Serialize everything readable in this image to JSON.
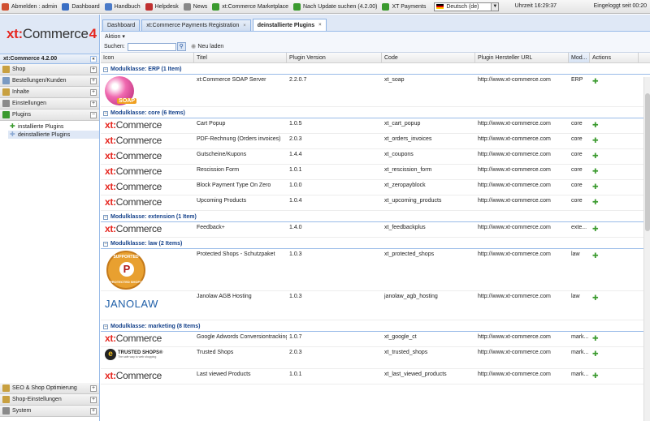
{
  "toolbar": {
    "items": [
      {
        "label": "Abmelden : admin",
        "icon": "logout-icon",
        "color": "#d05030"
      },
      {
        "label": "Dashboard",
        "icon": "dashboard-icon",
        "color": "#3a6fc4"
      },
      {
        "label": "Handbuch",
        "icon": "book-icon",
        "color": "#4a7ac8"
      },
      {
        "label": "Helpdesk",
        "icon": "helpdesk-icon",
        "color": "#c03030"
      },
      {
        "label": "News",
        "icon": "news-icon",
        "color": "#888888"
      },
      {
        "label": "xt:Commerce Marketplace",
        "icon": "marketplace-icon",
        "color": "#3a9a2e"
      },
      {
        "label": "Nach Update suchen (4.2.00)",
        "icon": "update-icon",
        "color": "#3a9a2e"
      },
      {
        "label": "XT Payments",
        "icon": "payments-icon",
        "color": "#3a9a2e"
      }
    ],
    "language": "Deutsch (de)",
    "time": "Uhrzeit 16:29:37",
    "login": "Eingeloggt seit 00:20"
  },
  "sidebar": {
    "logo_prefix": "xt",
    "logo_colon": ":",
    "logo_word": "Commerce",
    "logo_version": "4",
    "version": "xt:Commerce 4.2.00",
    "collapse": "«",
    "sections": [
      {
        "label": "Shop",
        "color": "#c8a040"
      },
      {
        "label": "Bestellungen/Kunden",
        "color": "#7a9ac2"
      },
      {
        "label": "Inhalte",
        "color": "#c8a040"
      },
      {
        "label": "Einstellungen",
        "color": "#8a8a8a"
      }
    ],
    "plugins_label": "Plugins",
    "expand": "+",
    "collapse_section": "−",
    "tree": [
      "installierte Plugins",
      "deinstallierte Plugins"
    ],
    "bottom_sections": [
      {
        "label": "SEO & Shop Optimierung",
        "color": "#c8a040"
      },
      {
        "label": "Shop-Einstellungen",
        "color": "#c8a040"
      },
      {
        "label": "System",
        "color": "#8a8a8a"
      }
    ]
  },
  "tabs": [
    {
      "label": "Dashboard",
      "active": false
    },
    {
      "label": "xt:Commerce Payments Registration",
      "active": false
    },
    {
      "label": "deinstallierte Plugins",
      "active": true
    }
  ],
  "tab_close": "×",
  "action_label": "Aktion ▾",
  "search": {
    "label": "Suchen:",
    "value": "",
    "reload": "Neu laden"
  },
  "columns": [
    "Icon",
    "Titel",
    "Plugin Version",
    "Code",
    "Plugin Hersteller URL",
    "Mod...",
    "Actions"
  ],
  "groups": [
    {
      "label": "Modulklasse: ERP (1 Item)",
      "rows": [
        {
          "icon": "soap",
          "title": "xt:Commerce SOAP Server",
          "version": "2.2.0.7",
          "code": "xt_soap",
          "url": "http://www.xt-commerce.com",
          "mod": "ERP"
        }
      ]
    },
    {
      "label": "Modulklasse: core (6 Items)",
      "rows": [
        {
          "icon": "xt",
          "title": "Cart Popup",
          "version": "1.0.5",
          "code": "xt_cart_popup",
          "url": "http://www.xt-commerce.com",
          "mod": "core"
        },
        {
          "icon": "xt",
          "title": "PDF-Rechnung (Orders invoices)",
          "version": "2.0.3",
          "code": "xt_orders_invoices",
          "url": "http://www.xt-commerce.com",
          "mod": "core"
        },
        {
          "icon": "xt",
          "title": "Gutscheine/Kupons",
          "version": "1.4.4",
          "code": "xt_coupons",
          "url": "http://www.xt-commerce.com",
          "mod": "core"
        },
        {
          "icon": "xt",
          "title": "Rescission Form",
          "version": "1.0.1",
          "code": "xt_rescission_form",
          "url": "http://www.xt-commerce.com",
          "mod": "core"
        },
        {
          "icon": "xt",
          "title": "Block Payment Type On Zero",
          "version": "1.0.0",
          "code": "xt_zeropayblock",
          "url": "http://www.xt-commerce.com",
          "mod": "core"
        },
        {
          "icon": "xt",
          "title": "Upcoming Products",
          "version": "1.0.4",
          "code": "xt_upcoming_products",
          "url": "http://www.xt-commerce.com",
          "mod": "core"
        }
      ]
    },
    {
      "label": "Modulklasse: extension (1 Item)",
      "rows": [
        {
          "icon": "xt",
          "title": "Feedback+",
          "version": "1.4.0",
          "code": "xt_feedbackplus",
          "url": "http://www.xt-commerce.com",
          "mod": "exte..."
        }
      ]
    },
    {
      "label": "Modulklasse: law (2 Items)",
      "rows": [
        {
          "icon": "ps",
          "title": "Protected Shops - Schutzpaket",
          "version": "1.0.3",
          "code": "xt_protected_shops",
          "url": "http://www.xt-commerce.com",
          "mod": "law"
        },
        {
          "icon": "janolaw",
          "title": "Janolaw AGB Hosting",
          "version": "1.0.3",
          "code": "janolaw_agb_hosting",
          "url": "http://www.xt-commerce.com",
          "mod": "law"
        }
      ]
    },
    {
      "label": "Modulklasse: marketing (8 Items)",
      "rows": [
        {
          "icon": "xt",
          "title": "Google Adwords Conversiontracking",
          "version": "1.0.7",
          "code": "xt_google_ct",
          "url": "http://www.xt-commerce.com",
          "mod": "mark..."
        },
        {
          "icon": "ts",
          "title": "Trusted Shops",
          "version": "2.0.3",
          "code": "xt_trusted_shops",
          "url": "http://www.xt-commerce.com",
          "mod": "mark..."
        },
        {
          "icon": "xt",
          "title": "Last viewed Products",
          "version": "1.0.1",
          "code": "xt_last_viewed_products",
          "url": "http://www.xt-commerce.com",
          "mod": "mark..."
        }
      ]
    }
  ],
  "logos": {
    "xt_prefix": "xt",
    "xt_colon": ":",
    "xt_word": "Commerce",
    "soap": "SOAP",
    "ps_top": "SUPPORTED",
    "ps_bottom": "PROTECTED SHOPS",
    "ps_mark": "P",
    "janolaw": "JANOLAW",
    "ts_mark": "e",
    "ts_name": "TRUSTED SHOPS®",
    "ts_tag": "The safe way to web shopping"
  },
  "action_icon": "install-puzzle-icon"
}
